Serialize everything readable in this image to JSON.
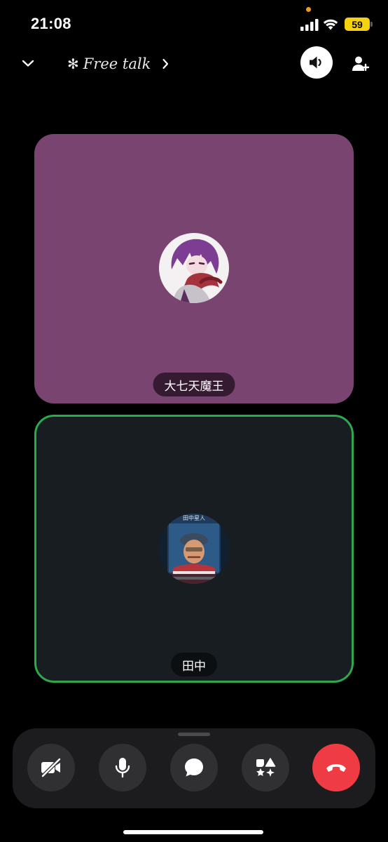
{
  "status_bar": {
    "time": "21:08",
    "battery": "59",
    "icons": [
      "signal-icon",
      "wifi-icon",
      "battery-icon"
    ],
    "battery_color": "#f6d20e",
    "privacy_dot_color": "#f29a1f"
  },
  "header": {
    "channel_icon": "✻",
    "channel_name": "Free talk",
    "icons": [
      "chevron-down-icon",
      "chevron-right-icon",
      "speaker-icon",
      "add-user-icon"
    ]
  },
  "participants": [
    {
      "name": "大七天魔王",
      "tile_color": "#7a4470",
      "speaking": false,
      "avatar": "anime-character-avatar"
    },
    {
      "name": "田中",
      "tile_color": "#181d22",
      "speaking": true,
      "speaking_color": "#2ea84d",
      "avatar": "helmeted-character-avatar",
      "avatar_caption": "田中星人"
    }
  ],
  "controls": {
    "icons": [
      "camera-off-icon",
      "microphone-icon",
      "chat-icon",
      "activities-icon",
      "hang-up-icon"
    ],
    "hangup_color": "#ef3b43"
  }
}
